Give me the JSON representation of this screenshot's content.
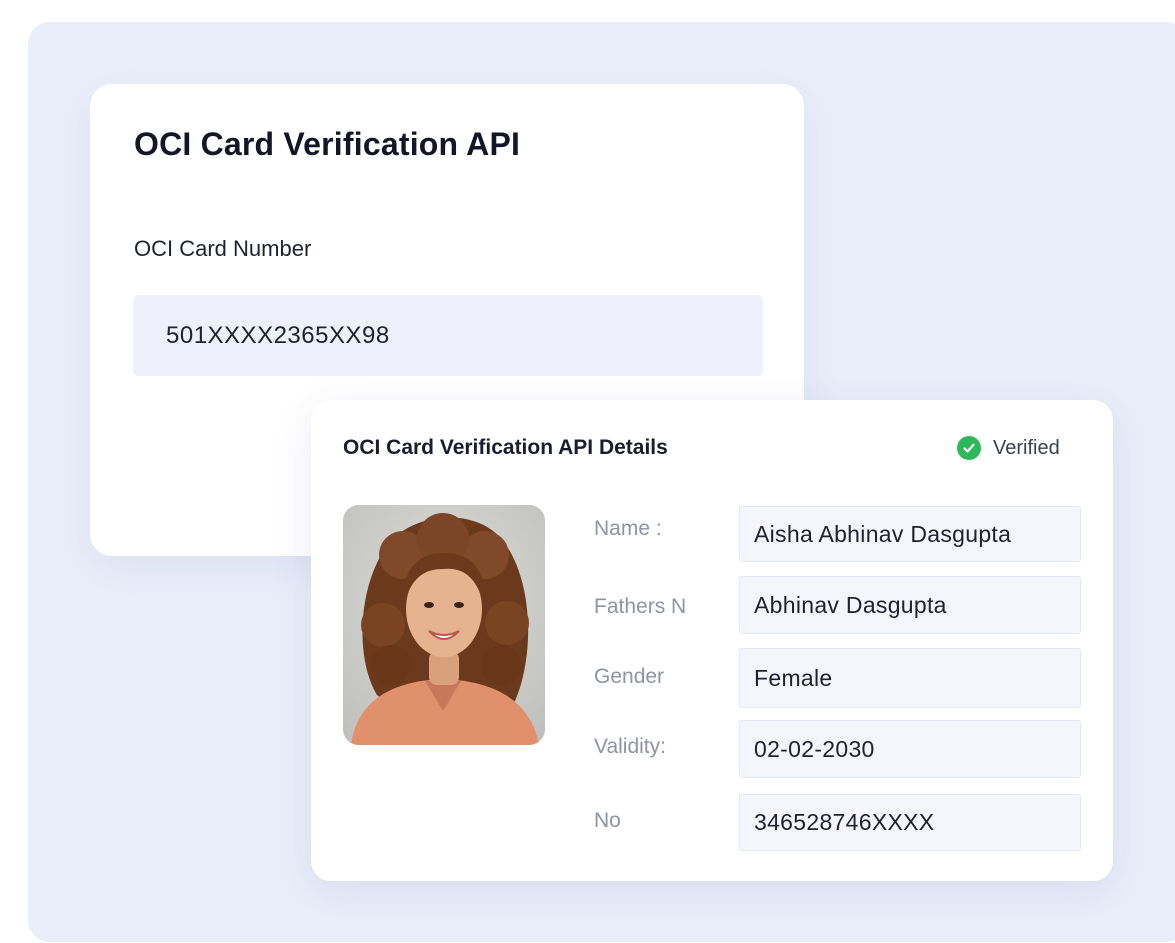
{
  "input_card": {
    "title": "OCI Card Verification API",
    "field_label": "OCI Card Number",
    "field_value": "501XXXX2365XX98"
  },
  "details_card": {
    "title": "OCI Card Verification API Details",
    "status": "Verified",
    "status_color": "#2eb85c",
    "photo": "portrait-photo",
    "fields": [
      {
        "label": "Name :",
        "value": "Aisha Abhinav Dasgupta"
      },
      {
        "label": "Fathers N",
        "value": "Abhinav Dasgupta"
      },
      {
        "label": "Gender",
        "value": "Female"
      },
      {
        "label": "Validity:",
        "value": "02-02-2030"
      },
      {
        "label": "No",
        "value": "346528746XXXX"
      }
    ]
  }
}
